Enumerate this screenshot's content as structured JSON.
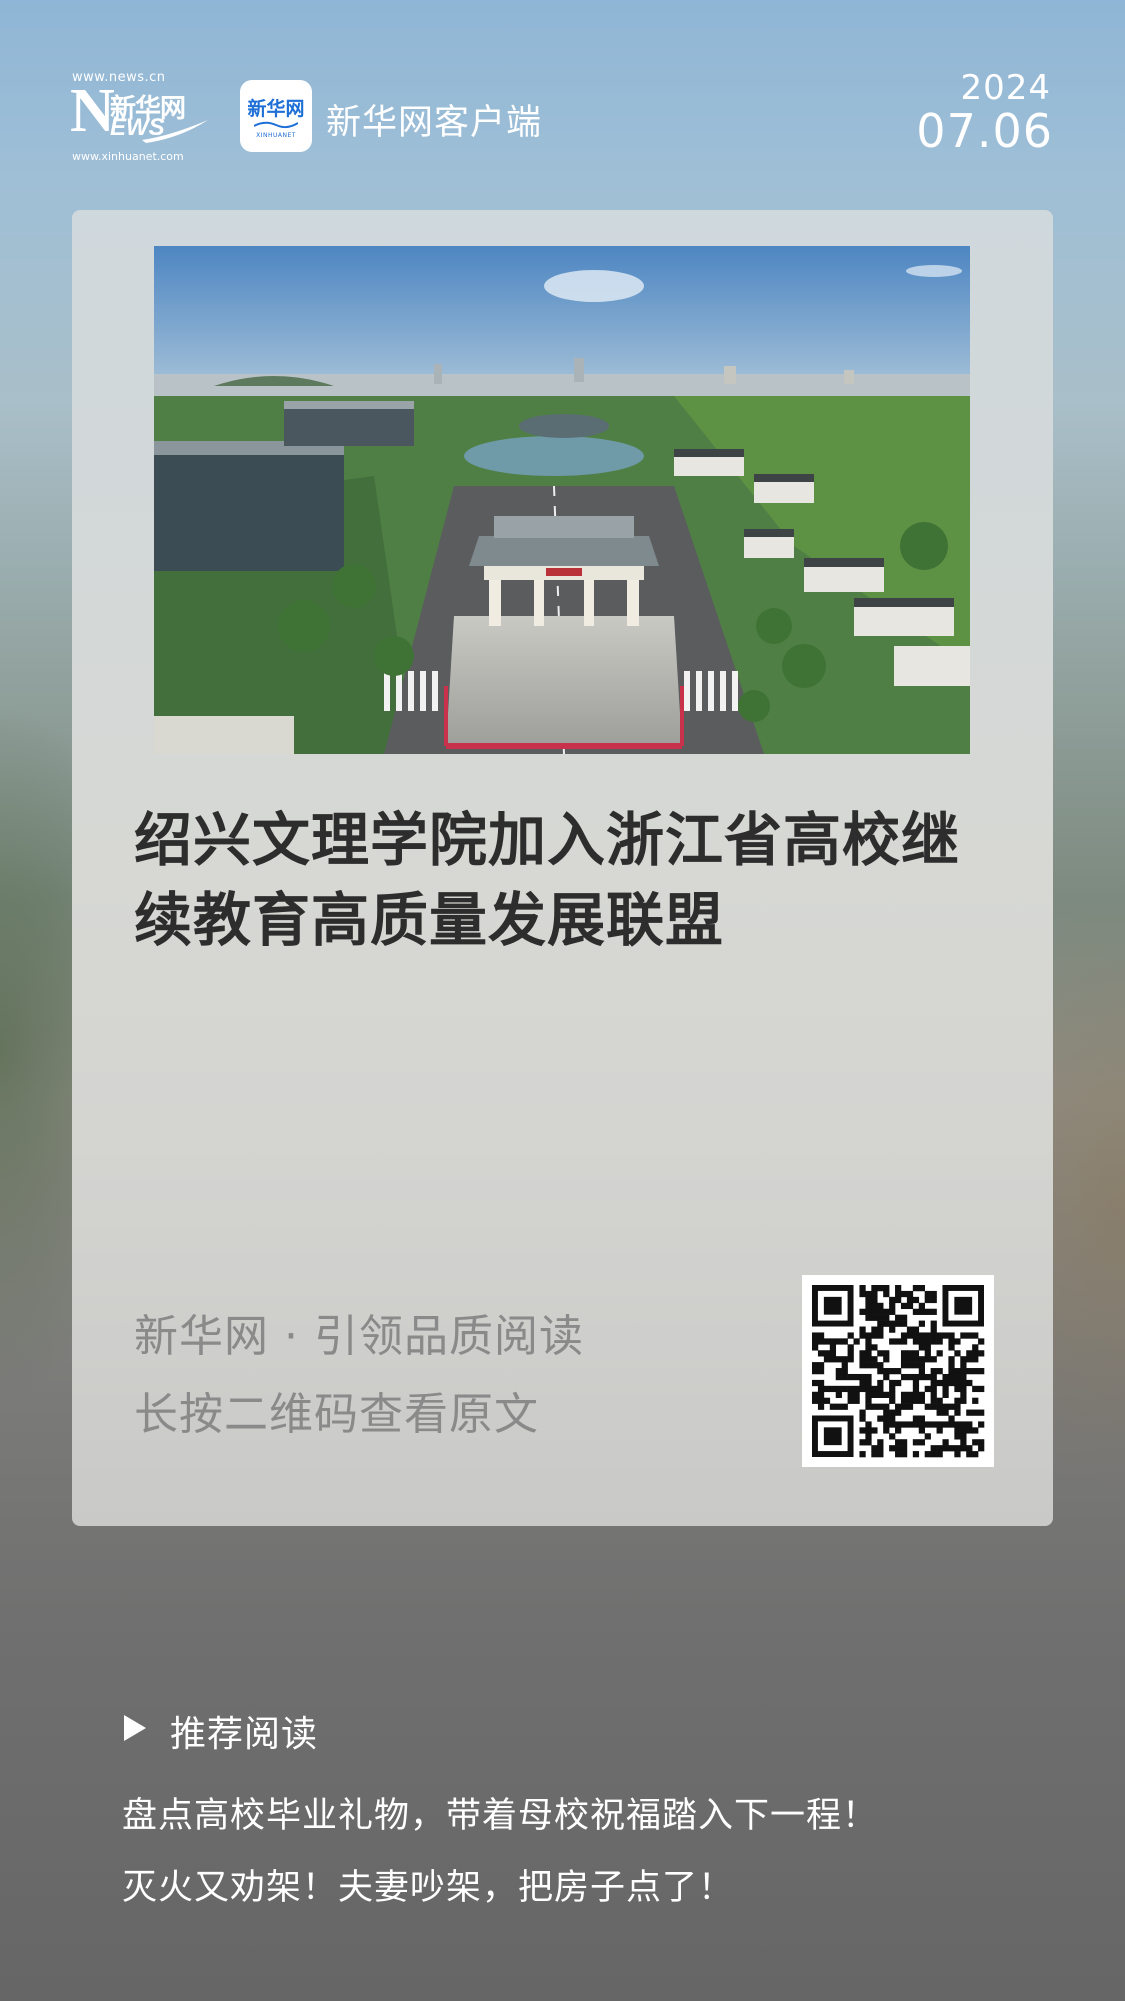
{
  "header": {
    "logo": {
      "url_top": "www.news.cn",
      "big_letter": "N",
      "cn_text": "新华网",
      "en_text": "EWS",
      "url_bottom": "www.xinhuanet.com"
    },
    "app_icon": {
      "cn_text": "新华网",
      "en_text": "XINHUANET"
    },
    "app_name": "新华网客户端",
    "date_year": "2024",
    "date_md": "07.06"
  },
  "card": {
    "title": "绍兴文理学院加入浙江省高校继续教育高质量发展联盟",
    "slogan": "新华网 · 引领品质阅读",
    "hint": "长按二维码查看原文"
  },
  "recommended": {
    "heading": "推荐阅读",
    "items": [
      "盘点高校毕业礼物，带着母校祝福踏入下一程！",
      "灭火又劝架！夫妻吵架，把房子点了！"
    ]
  },
  "colors": {
    "title_text": "#2d2d2d",
    "muted_text": "#8a8a8a",
    "accent_blue": "#1e6fd6"
  }
}
